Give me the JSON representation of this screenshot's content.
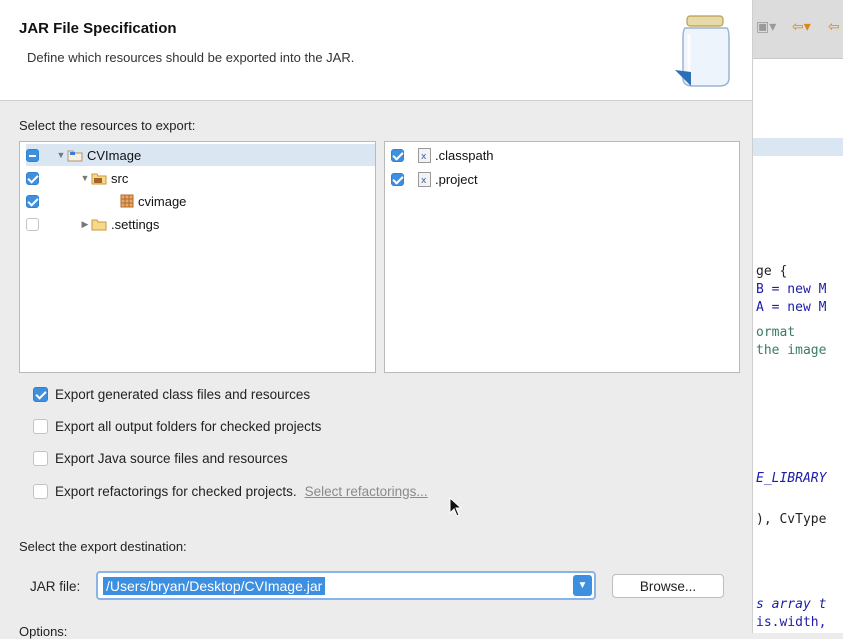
{
  "dialog": {
    "title": "JAR File Specification",
    "subtitle": "Define which resources should be exported into the JAR."
  },
  "resources": {
    "label": "Select the resources to export:",
    "tree": [
      {
        "label": "CVImage",
        "check": "mixed",
        "icon": "project-folder-icon",
        "expanded": true
      },
      {
        "label": "src",
        "check": "checked",
        "icon": "source-folder-icon",
        "expanded": true
      },
      {
        "label": "cvimage",
        "check": "checked",
        "icon": "package-icon"
      },
      {
        "label": ".settings",
        "check": "unchecked",
        "icon": "folder-icon",
        "expanded": false
      }
    ],
    "files": [
      {
        "label": ".classpath",
        "check": "checked",
        "icon": "xml-file-icon"
      },
      {
        "label": ".project",
        "check": "checked",
        "icon": "xml-file-icon"
      }
    ]
  },
  "options": [
    {
      "label": "Export generated class files and resources",
      "checked": true
    },
    {
      "label": "Export all output folders for checked projects",
      "checked": false
    },
    {
      "label": "Export Java source files and resources",
      "checked": false
    },
    {
      "label": "Export refactorings for checked projects.",
      "checked": false,
      "link": "Select refactorings..."
    }
  ],
  "destination": {
    "label": "Select the export destination:",
    "jar_label": "JAR file:",
    "jar_value": "/Users/bryan/Desktop/CVImage.jar",
    "browse_label": "Browse...",
    "options_label": "Options:"
  },
  "background_code": [
    "ge {",
    "B = new M",
    "A = new M",
    "ormat",
    "the image",
    "E_LIBRARY",
    "), CvType",
    "s array t",
    "is.width,"
  ],
  "colors": {
    "accent": "#3d8fe0",
    "selection": "#dbe6f3"
  }
}
